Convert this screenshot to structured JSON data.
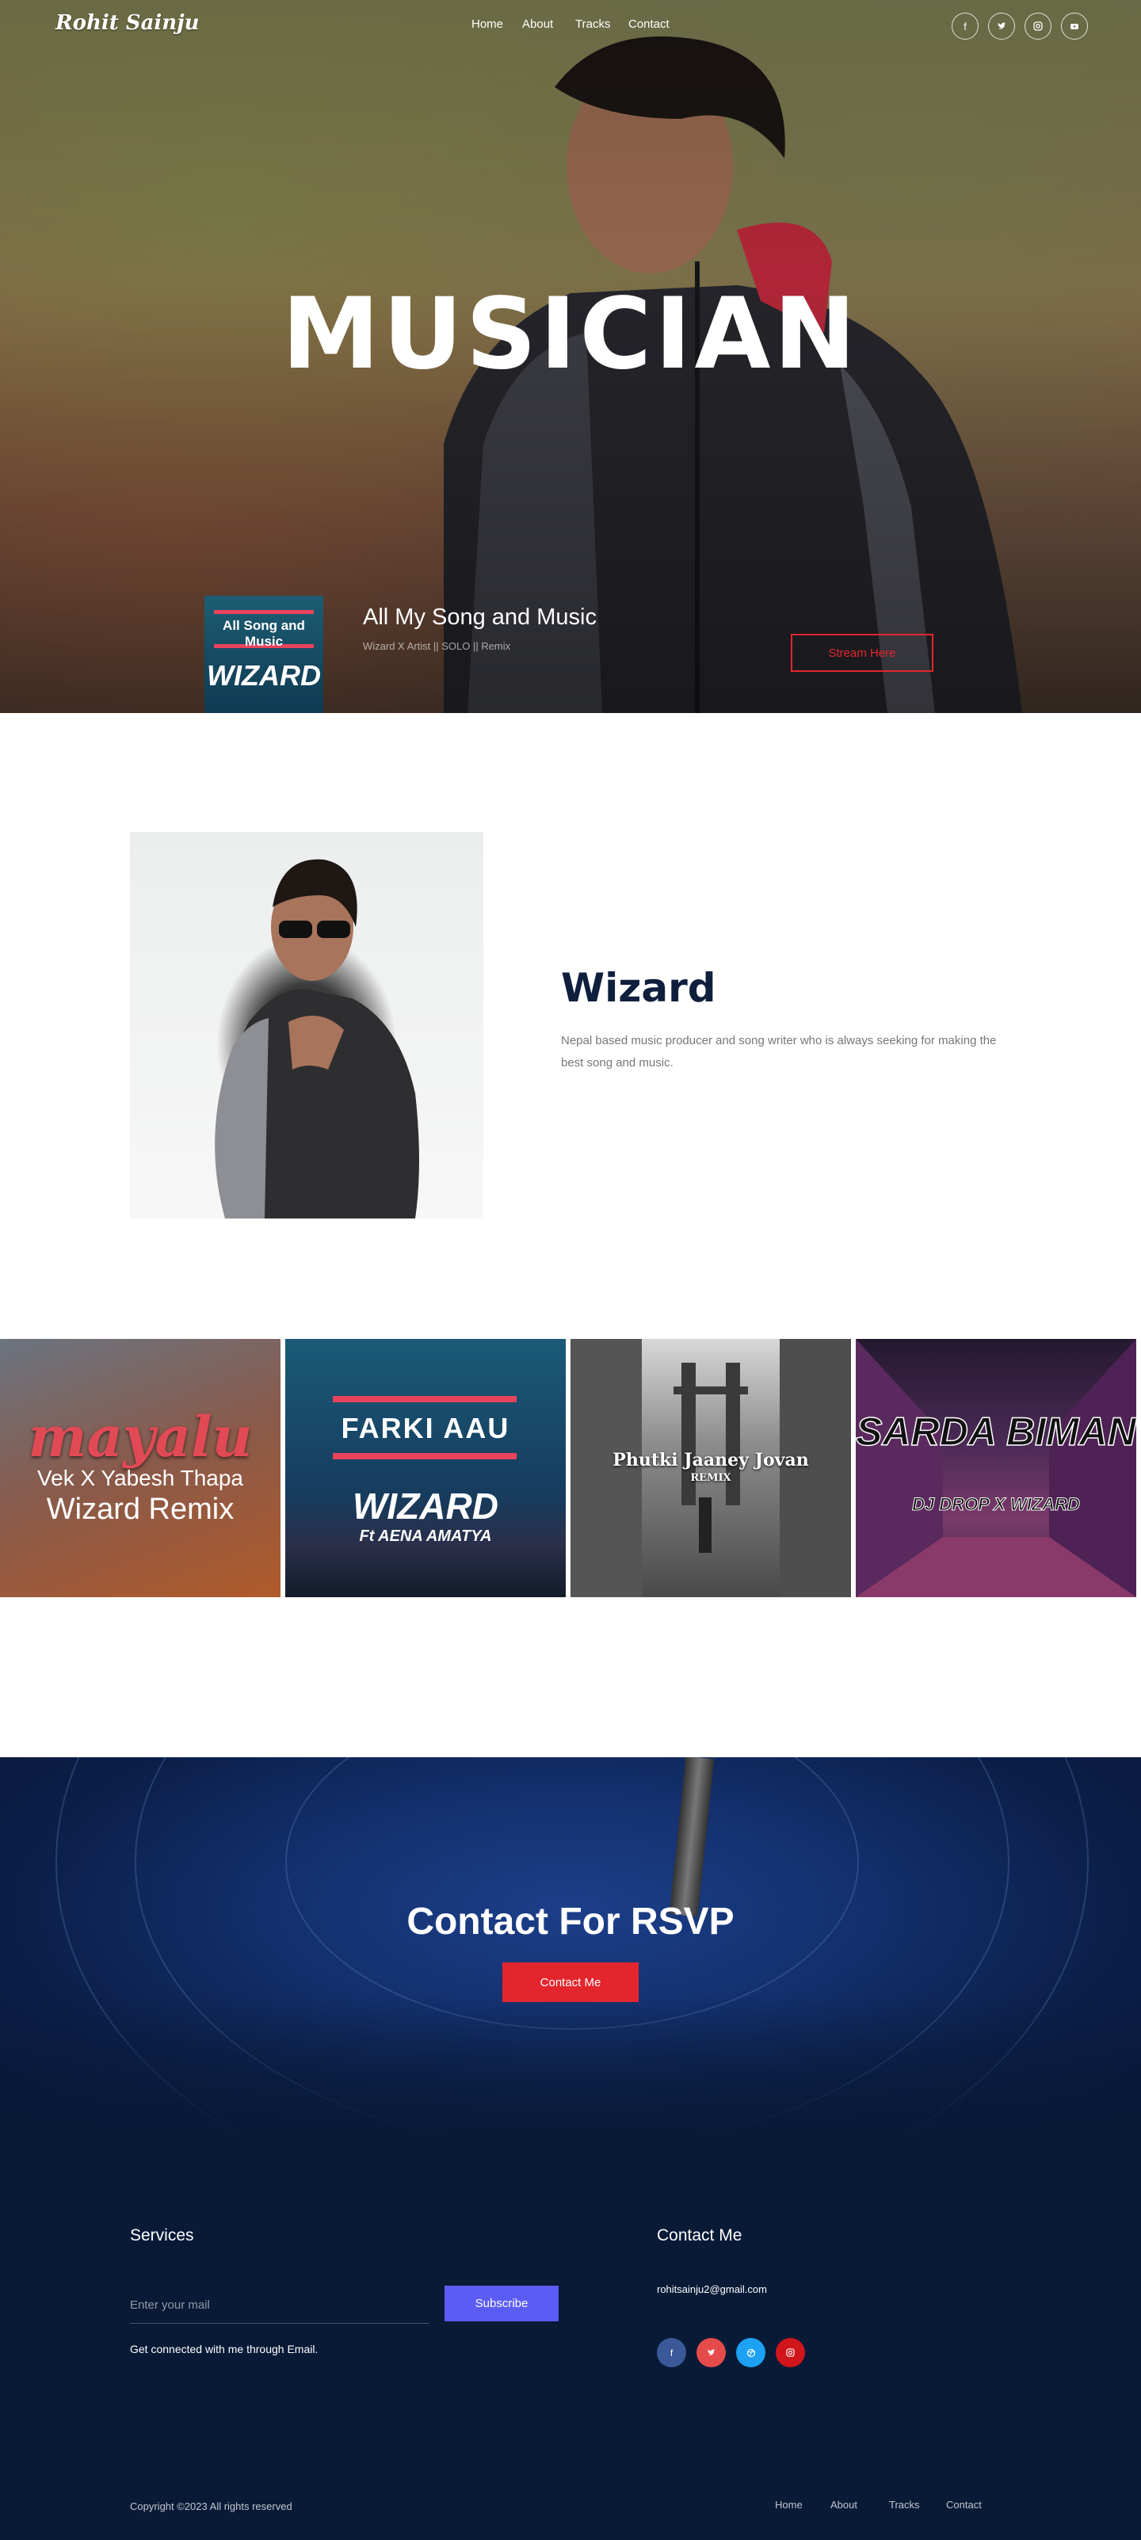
{
  "header": {
    "logo": "Rohit Sainju",
    "nav": [
      "Home",
      "About",
      "Tracks",
      "Contact"
    ],
    "social_icons": [
      "facebook-icon",
      "twitter-icon",
      "instagram-icon",
      "youtube-icon"
    ]
  },
  "hero": {
    "title": "MUSICIAN",
    "album_art": {
      "line1": "All Song and Music",
      "line2": "WIZARD"
    },
    "song_title": "All My Song and Music",
    "song_subtitle": "Wizard X Artist || SOLO || Remix",
    "stream_button": "Stream Here"
  },
  "about": {
    "name": "Wizard",
    "description": "Nepal based music producer and song writer who is always seeking for making the best song and music."
  },
  "gallery": [
    {
      "title": "mayalu",
      "line2": "Vek X Yabesh Thapa",
      "line3": "Wizard Remix"
    },
    {
      "title": "FARKI AAU",
      "line2": "WIZARD",
      "line3": "Ft AENA AMATYA"
    },
    {
      "title": "Phutki Jaaney Jovan",
      "line2": "REMIX"
    },
    {
      "title": "SARDA BIMAN",
      "line2": "DJ DROP X WIZARD"
    }
  ],
  "rsvp": {
    "title": "Contact For RSVP",
    "button": "Contact Me"
  },
  "footer": {
    "services_heading": "Services",
    "email_placeholder": "Enter your mail",
    "subscribe_button": "Subscribe",
    "services_text": "Get connected with me through Email.",
    "contact_heading": "Contact Me",
    "email": "rohitsainju2@gmail.com",
    "social_icons": [
      "facebook-icon",
      "twitter-icon",
      "dribbble-icon",
      "instagram-icon"
    ],
    "social_colors": [
      "#3b5998",
      "#e54b4b",
      "#1da1f2",
      "#d0161b"
    ],
    "copyright": "Copyright ©2023 All rights reserved",
    "nav": [
      "Home",
      "About",
      "Tracks",
      "Contact"
    ]
  },
  "colors": {
    "accent_red": "#e3262d",
    "subscribe_purple": "#5b5cf6",
    "footer_bg": "#081a36",
    "heading_navy": "#0f1f3d"
  }
}
